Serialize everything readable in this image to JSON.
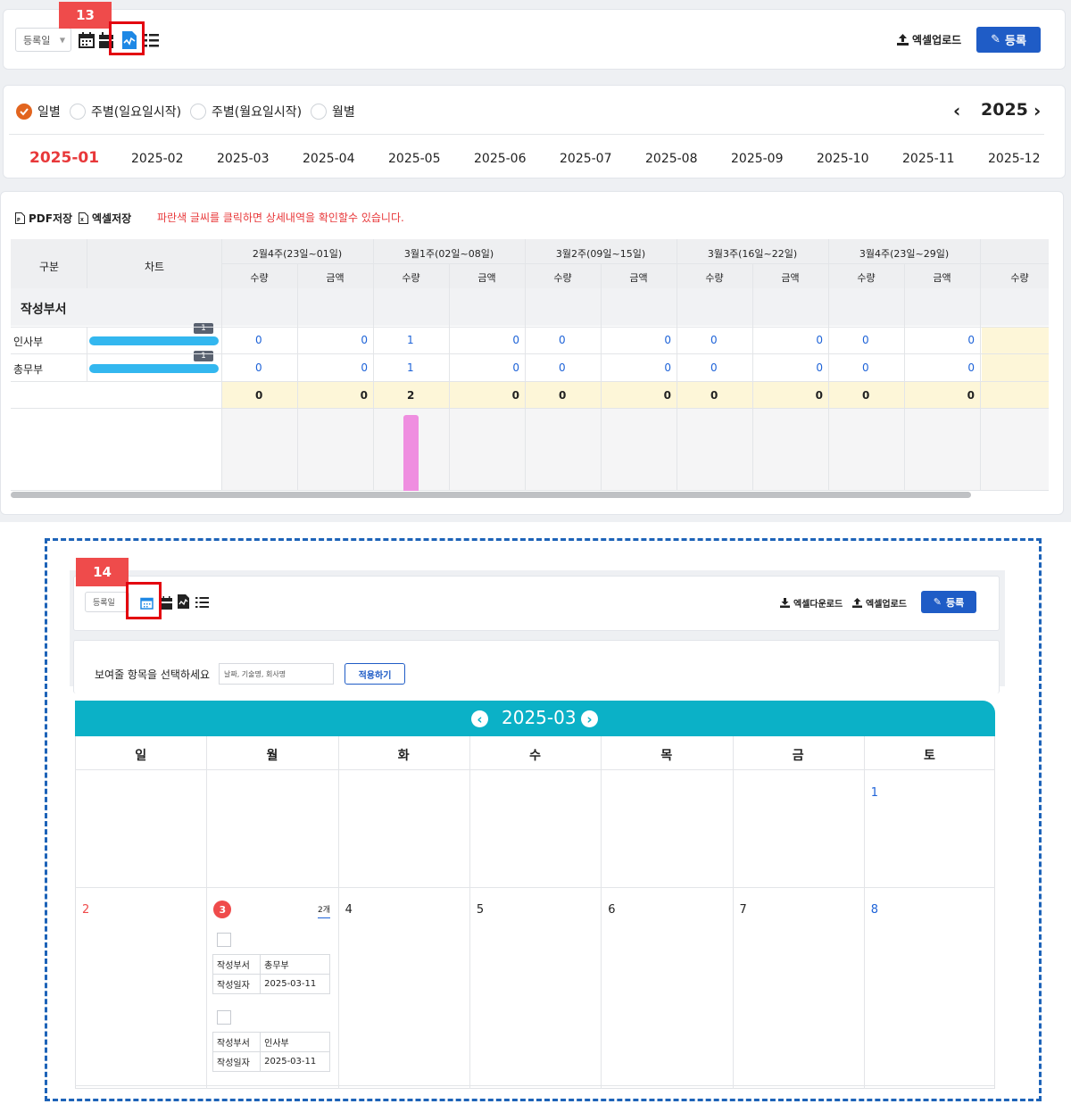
{
  "top": {
    "tag": "13",
    "select": "등록일",
    "upload": "엑셀업로드",
    "register": "등록"
  },
  "period": {
    "options": [
      "일별",
      "주별(일요일시작)",
      "주별(월요일시작)",
      "월별"
    ],
    "year": "2025",
    "months": [
      "2025-01",
      "2025-02",
      "2025-03",
      "2025-04",
      "2025-05",
      "2025-06",
      "2025-07",
      "2025-08",
      "2025-09",
      "2025-10",
      "2025-11",
      "2025-12"
    ]
  },
  "report": {
    "pdf": "PDF저장",
    "excel": "엑셀저장",
    "notice": "파란색 글씨를 클릭하면 상세내역을 확인할수 있습니다.",
    "col_group": "구분",
    "col_chart": "차트",
    "weeks": [
      "2월4주(23일~01일)",
      "3월1주(02일~08일)",
      "3월2주(09일~15일)",
      "3월3주(16일~22일)",
      "3월4주(23일~29일)"
    ],
    "qty": "수량",
    "amt": "금액",
    "section": "작성부서",
    "rows": [
      {
        "name": "인사부",
        "badge": "1",
        "vals": [
          "0",
          "0",
          "1",
          "0",
          "0",
          "0",
          "0",
          "0",
          "0",
          "0"
        ]
      },
      {
        "name": "총무부",
        "badge": "1",
        "vals": [
          "0",
          "0",
          "1",
          "0",
          "0",
          "0",
          "0",
          "0",
          "0",
          "0"
        ]
      }
    ],
    "total": [
      "0",
      "0",
      "2",
      "0",
      "0",
      "0",
      "0",
      "0",
      "0",
      "0"
    ],
    "colors": {
      "bar": "#33b7ef",
      "pink": "#ef8ee0",
      "total_bg": "#fdf6d8"
    }
  },
  "bottom": {
    "tag": "14",
    "select": "등록일",
    "download": "엑셀다운로드",
    "upload": "엑셀업로드",
    "register": "등록",
    "filter_label": "보여줄 항목을 선택하세요",
    "filter_value": "날짜, 기술명, 회사명",
    "apply": "적용하기",
    "month": "2025-03",
    "weekdays": [
      "일",
      "월",
      "화",
      "수",
      "목",
      "금",
      "토"
    ],
    "week1": [
      "",
      "",
      "",
      "",
      "",
      "",
      "1"
    ],
    "week2": [
      "2",
      "3",
      "4",
      "5",
      "6",
      "7",
      "8"
    ],
    "count": "2개",
    "cards": [
      {
        "k1": "작성부서",
        "v1": "총무부",
        "k2": "작성일자",
        "v2": "2025-03-11"
      },
      {
        "k1": "작성부서",
        "v1": "인사부",
        "k2": "작성일자",
        "v2": "2025-03-11"
      }
    ],
    "teal": "#0bb1c7"
  }
}
